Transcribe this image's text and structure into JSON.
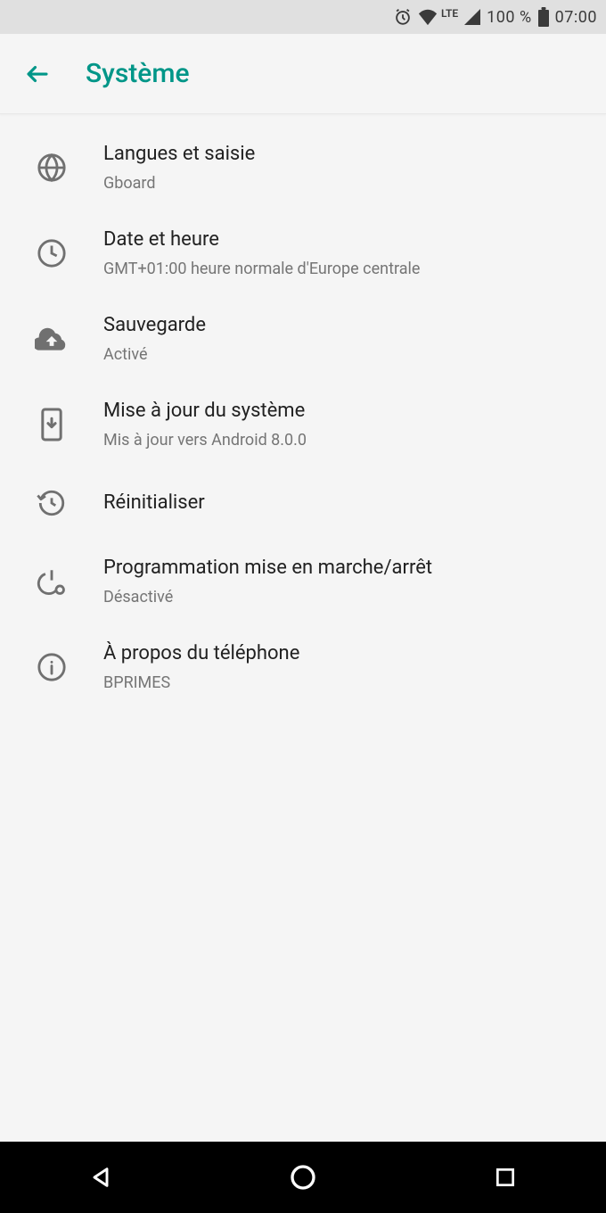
{
  "status_bar": {
    "network_label": "LTE",
    "battery_text": "100 %",
    "time": "07:00"
  },
  "header": {
    "title": "Système"
  },
  "items": [
    {
      "title": "Langues et saisie",
      "subtitle": "Gboard",
      "icon": "globe"
    },
    {
      "title": "Date et heure",
      "subtitle": "GMT+01:00 heure normale d'Europe centrale",
      "icon": "clock"
    },
    {
      "title": "Sauvegarde",
      "subtitle": "Activé",
      "icon": "cloud-upload"
    },
    {
      "title": "Mise à jour du système",
      "subtitle": "Mis à jour vers Android 8.0.0",
      "icon": "system-update"
    },
    {
      "title": "Réinitialiser",
      "subtitle": null,
      "icon": "restore"
    },
    {
      "title": "Programmation mise en marche/arrêt",
      "subtitle": "Désactivé",
      "icon": "power-schedule"
    },
    {
      "title": "À propos du téléphone",
      "subtitle": "BPRIMES",
      "icon": "info"
    }
  ]
}
